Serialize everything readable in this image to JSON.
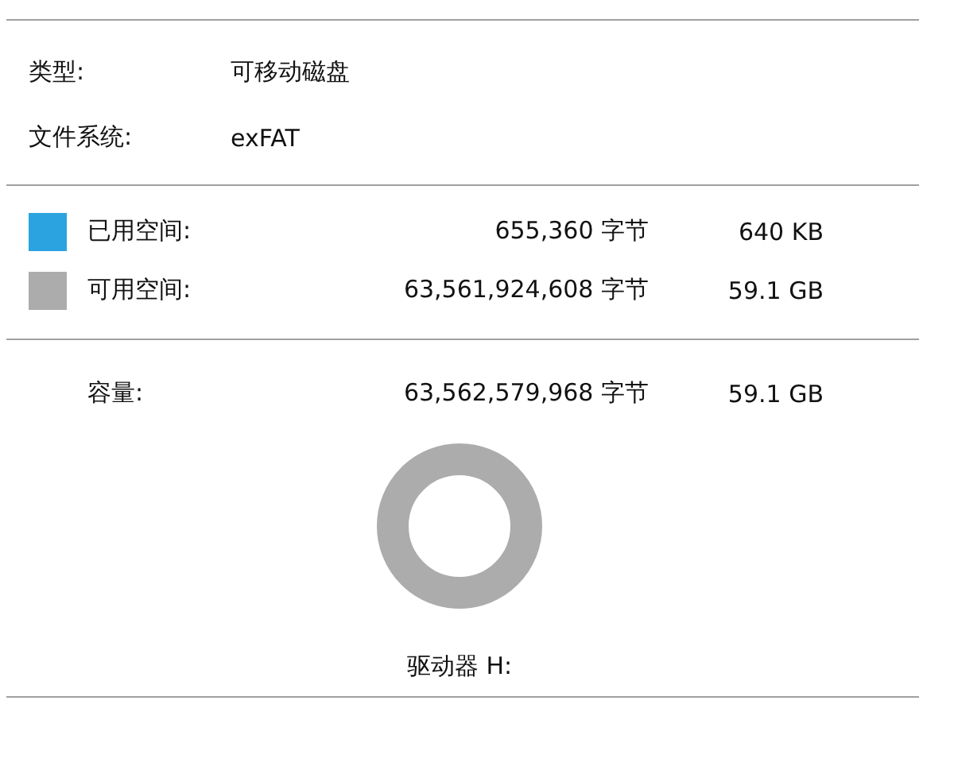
{
  "properties": [
    {
      "label": "类型:",
      "value": "可移动磁盘"
    },
    {
      "label": "文件系统:",
      "value": "exFAT"
    }
  ],
  "usage": [
    {
      "label": "已用空间:",
      "bytes": "655,360 字节",
      "size": "640 KB",
      "color": "#2aa3e0"
    },
    {
      "label": "可用空间:",
      "bytes": "63,561,924,608 字节",
      "size": "59.1 GB",
      "color": "#acacac"
    }
  ],
  "capacity": {
    "label": "容量:",
    "bytes": "63,562,579,968 字节",
    "size": "59.1 GB"
  },
  "drive_label": "驱动器 H:"
}
